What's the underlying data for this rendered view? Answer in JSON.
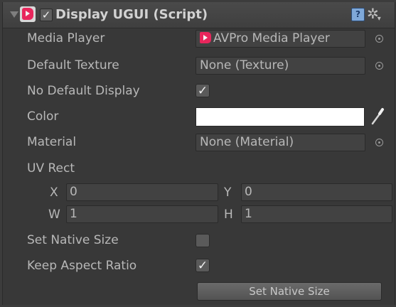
{
  "component": {
    "title": "Display UGUI (Script)",
    "enabled": true,
    "icon": "media-player-icon",
    "help_icon": "?",
    "menu_icon": "gear-icon"
  },
  "fields": {
    "media_player": {
      "label": "Media Player",
      "value": "AVPro Media Player"
    },
    "default_texture": {
      "label": "Default Texture",
      "value": "None (Texture)"
    },
    "no_default_display": {
      "label": "No Default Display",
      "checked": true
    },
    "color": {
      "label": "Color",
      "value": "#ffffff"
    },
    "material": {
      "label": "Material",
      "value": "None (Material)"
    },
    "uv_rect": {
      "label": "UV Rect",
      "x_label": "X",
      "x": "0",
      "y_label": "Y",
      "y": "0",
      "w_label": "W",
      "w": "1",
      "h_label": "H",
      "h": "1"
    },
    "set_native_size": {
      "label": "Set Native Size",
      "checked": false
    },
    "keep_aspect_ratio": {
      "label": "Keep Aspect Ratio",
      "checked": true
    }
  },
  "button": {
    "label": "Set Native Size"
  },
  "glyphs": {
    "check": "✓"
  },
  "colors": {
    "accent": "#e8265c",
    "background": "#383838"
  }
}
